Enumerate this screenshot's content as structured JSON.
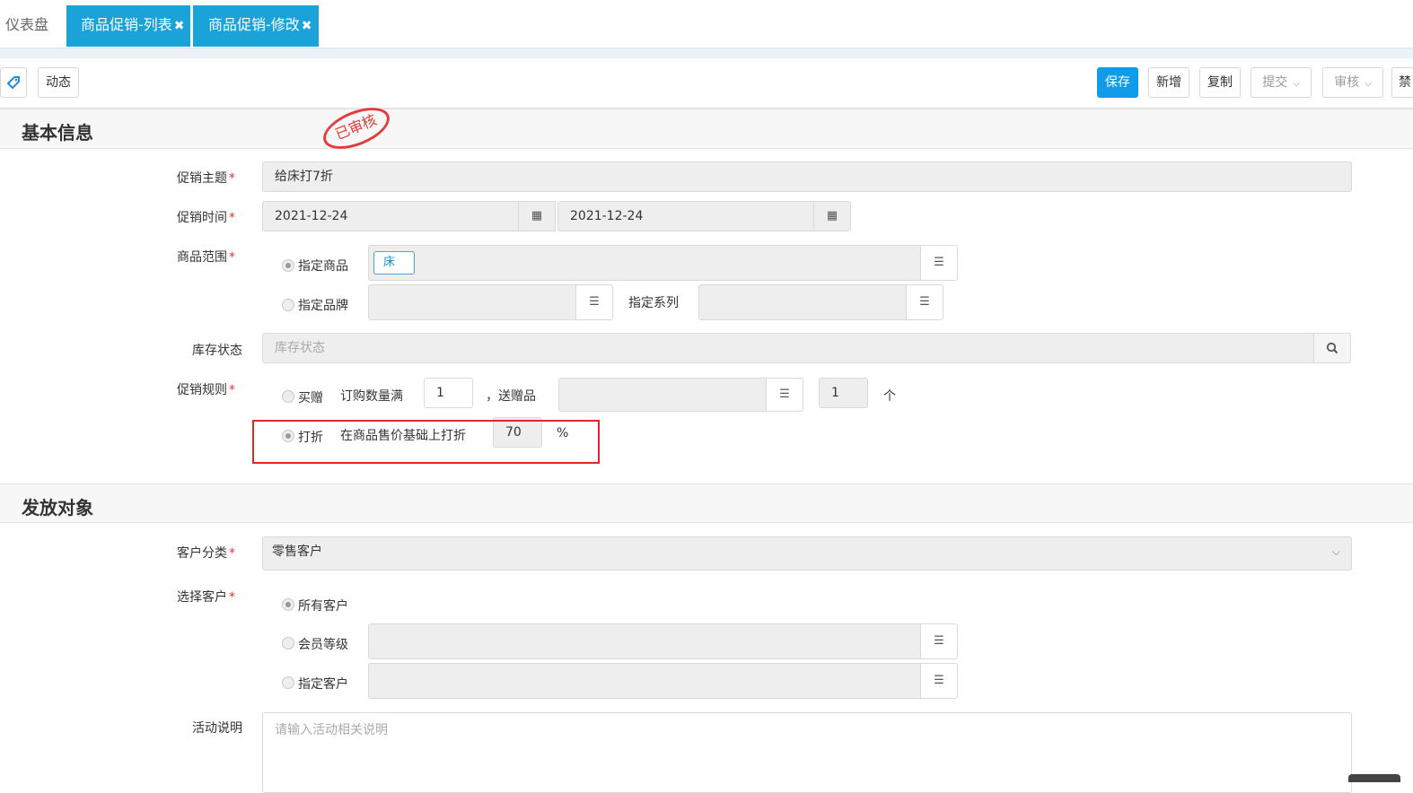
{
  "tabs": [
    {
      "label": "仪表盘"
    },
    {
      "label": "商品促销-列表"
    },
    {
      "label": "商品促销-修改"
    }
  ],
  "toolbar": {
    "dynamic_label": "动态",
    "save_label": "保存",
    "new_label": "新增",
    "copy_label": "复制",
    "submit_label": "提交",
    "audit_label": "审核",
    "cut_label": "禁"
  },
  "stamp_text": "已审核",
  "basic": {
    "title": "基本信息",
    "subject": {
      "label": "促销主题",
      "value": "给床打7折"
    },
    "time": {
      "label": "促销时间",
      "start": "2021-12-24",
      "end": "2021-12-24"
    },
    "scope": {
      "label": "商品范围",
      "specified_goods": "指定商品",
      "goods_chip": "床",
      "specified_brand": "指定品牌",
      "specified_series": "指定系列"
    },
    "stock": {
      "label": "库存状态",
      "placeholder": "库存状态"
    },
    "rule": {
      "label": "促销规则",
      "buy_gift": "买赠",
      "order_qty_text": "订购数量满",
      "order_qty": "1",
      "gift_text": "，送赠品",
      "gift_qty": "1",
      "unit": "个",
      "discount": "打折",
      "discount_text": "在商品售价基础上打折",
      "discount_value": "70",
      "percent": "%"
    }
  },
  "target": {
    "title": "发放对象",
    "customer_category": {
      "label": "客户分类",
      "value": "零售客户"
    },
    "select_customer": {
      "label": "选择客户",
      "all": "所有客户",
      "member_level": "会员等级",
      "specified": "指定客户"
    },
    "description": {
      "label": "活动说明",
      "placeholder": "请输入活动相关说明"
    }
  },
  "colors": {
    "primary": "#129ce8",
    "tab": "#1ba2d8",
    "required": "#e33333",
    "highlight": "#e32727"
  }
}
